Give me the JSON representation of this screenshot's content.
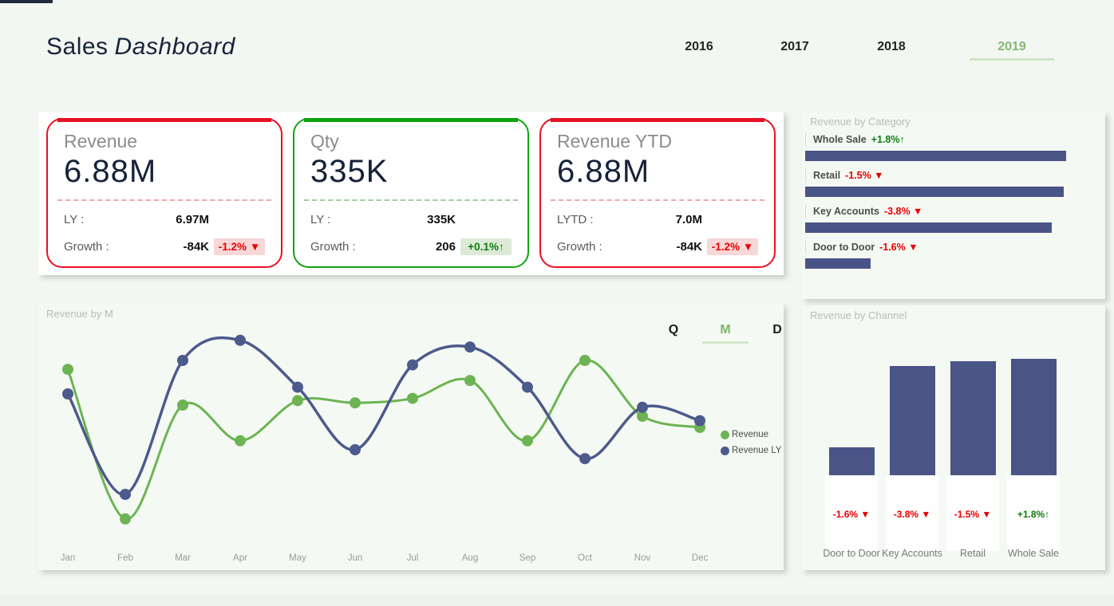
{
  "colors": {
    "accent_red": "#e81123",
    "accent_green": "#12a312",
    "badge_negative_text": "#e60000",
    "badge_positive_text": "#107c10",
    "line_green": "#6cb453",
    "line_navy": "#4d5a8c",
    "bar_navy": "#4a5486",
    "active_year_green": "#86b876"
  },
  "header": {
    "title_regular": "Sales",
    "title_italic": "Dashboard",
    "years": [
      {
        "label": "2016",
        "active": false
      },
      {
        "label": "2017",
        "active": false
      },
      {
        "label": "2018",
        "active": false
      },
      {
        "label": "2019",
        "active": true
      }
    ]
  },
  "kpi_cards": [
    {
      "title": "Revenue",
      "value": "6.88M",
      "accent": "red",
      "rows": [
        {
          "label": "LY :",
          "value": "6.97M",
          "badge": "",
          "badge_type": ""
        },
        {
          "label": "Growth :",
          "value": "-84K",
          "badge": "-1.2% ▼",
          "badge_type": "negative"
        }
      ]
    },
    {
      "title": "Qty",
      "value": "335K",
      "accent": "green",
      "rows": [
        {
          "label": "LY :",
          "value": "335K",
          "badge": "",
          "badge_type": ""
        },
        {
          "label": "Growth :",
          "value": "206",
          "badge": "+0.1%↑",
          "badge_type": "positive"
        }
      ]
    },
    {
      "title": "Revenue YTD",
      "value": "6.88M",
      "accent": "red",
      "rows": [
        {
          "label": "LYTD :",
          "value": "7.0M",
          "badge": "",
          "badge_type": ""
        },
        {
          "label": "Growth :",
          "value": "-84K",
          "badge": "-1.2% ▼",
          "badge_type": "negative"
        }
      ]
    }
  ],
  "category_panel": {
    "title": "Revenue by Category"
  },
  "line_panel": {
    "title": "Revenue by M",
    "toggles": [
      {
        "label": "Q",
        "active": false
      },
      {
        "label": "M",
        "active": true
      },
      {
        "label": "D",
        "active": false
      }
    ],
    "legend": [
      {
        "label": "Revenue",
        "color": "#6cb453"
      },
      {
        "label": "Revenue LY",
        "color": "#4d5a8c"
      }
    ]
  },
  "channel_panel": {
    "title": "Revenue by Channel"
  },
  "chart_data": [
    {
      "id": "revenue_by_month",
      "type": "line",
      "title": "Revenue by M",
      "x": [
        "Jan",
        "Feb",
        "Mar",
        "Apr",
        "May",
        "Jun",
        "Jul",
        "Aug",
        "Sep",
        "Oct",
        "Nov",
        "Dec"
      ],
      "series": [
        {
          "name": "Revenue",
          "color": "#6cb453",
          "values": [
            81,
            14,
            65,
            49,
            67,
            66,
            68,
            76,
            49,
            85,
            60,
            55
          ]
        },
        {
          "name": "Revenue LY",
          "color": "#4d5a8c",
          "values": [
            70,
            25,
            85,
            94,
            73,
            45,
            83,
            91,
            73,
            41,
            64,
            58
          ]
        }
      ],
      "ylim": [
        0,
        100
      ],
      "units": "relative height, no value axis shown",
      "grid": false,
      "legend_position": "right"
    },
    {
      "id": "revenue_by_category",
      "type": "bar-horizontal",
      "title": "Revenue by Category",
      "categories": [
        "Whole Sale",
        "Retail",
        "Key Accounts",
        "Door to Door"
      ],
      "values_pct_of_width": [
        88,
        87,
        83,
        22
      ],
      "growth_labels": [
        "+1.8%↑",
        "-1.5% ▼",
        "-3.8% ▼",
        "-1.6% ▼"
      ],
      "growth_types": [
        "positive",
        "negative",
        "negative",
        "negative"
      ],
      "bar_color": "#4a5486",
      "grid": false
    },
    {
      "id": "revenue_by_channel",
      "type": "bar",
      "title": "Revenue by Channel",
      "categories": [
        "Door to Door",
        "Key Accounts",
        "Retail",
        "Whole Sale"
      ],
      "values_pct_of_plot_height": [
        23,
        91,
        95,
        97
      ],
      "growth_labels": [
        "-1.6% ▼",
        "-3.8% ▼",
        "-1.5% ▼",
        "+1.8%↑"
      ],
      "growth_types": [
        "negative",
        "negative",
        "negative",
        "positive"
      ],
      "bar_color": "#4a5486",
      "grid": false
    }
  ]
}
